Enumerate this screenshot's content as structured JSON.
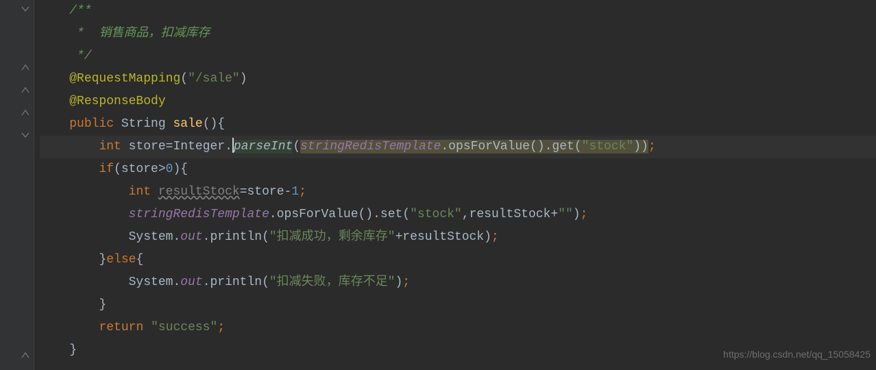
{
  "code": {
    "l1": "/**",
    "l2_prefix": " *  ",
    "l2_text": "销售商品，扣减库存",
    "l3": " */",
    "l4_ann": "@RequestMapping",
    "l4_paren_open": "(",
    "l4_str": "\"/sale\"",
    "l4_paren_close": ")",
    "l5_ann": "@ResponseBody",
    "l6_kw": "public ",
    "l6_type": "String ",
    "l6_method": "sale",
    "l6_tail": "(){",
    "l7_indent": "    ",
    "l7_kw": "int ",
    "l7_var": "store=Integer.",
    "l7_parseInt": "parseInt",
    "l7_paren": "(",
    "l7_srt": "stringRedisTemplate",
    "l7_ops": ".opsForValue().get(",
    "l7_stock": "\"stock\"",
    "l7_close": "))",
    "l7_semi": ";",
    "l8_indent": "    ",
    "l8_kw": "if",
    "l8_cond": "(store>",
    "l8_zero": "0",
    "l8_brace": "){",
    "l9_indent": "        ",
    "l9_kw": "int ",
    "l9_var": "resultStock",
    "l9_assign": "=store-",
    "l9_one": "1",
    "l9_semi": ";",
    "l10_indent": "        ",
    "l10_srt": "stringRedisTemplate",
    "l10_ops": ".opsForValue().set(",
    "l10_stock": "\"stock\"",
    "l10_comma": ",resultStock+",
    "l10_empty": "\"\"",
    "l10_close": ")",
    "l10_semi": ";",
    "l11_indent": "        System.",
    "l11_out": "out",
    "l11_println": ".println(",
    "l11_str": "\"扣减成功，剩余库存\"",
    "l11_plus": "+resultStock)",
    "l11_semi": ";",
    "l12_indent": "    }",
    "l12_else": "else",
    "l12_brace": "{",
    "l13_indent": "        System.",
    "l13_out": "out",
    "l13_println": ".println(",
    "l13_str": "\"扣减失败，库存不足\"",
    "l13_close": ")",
    "l13_semi": ";",
    "l14": "    }",
    "l15_indent": "    ",
    "l15_return": "return ",
    "l15_str": "\"success\"",
    "l15_semi": ";",
    "l16": "}"
  },
  "watermark": "https://blog.csdn.net/qq_15058425"
}
